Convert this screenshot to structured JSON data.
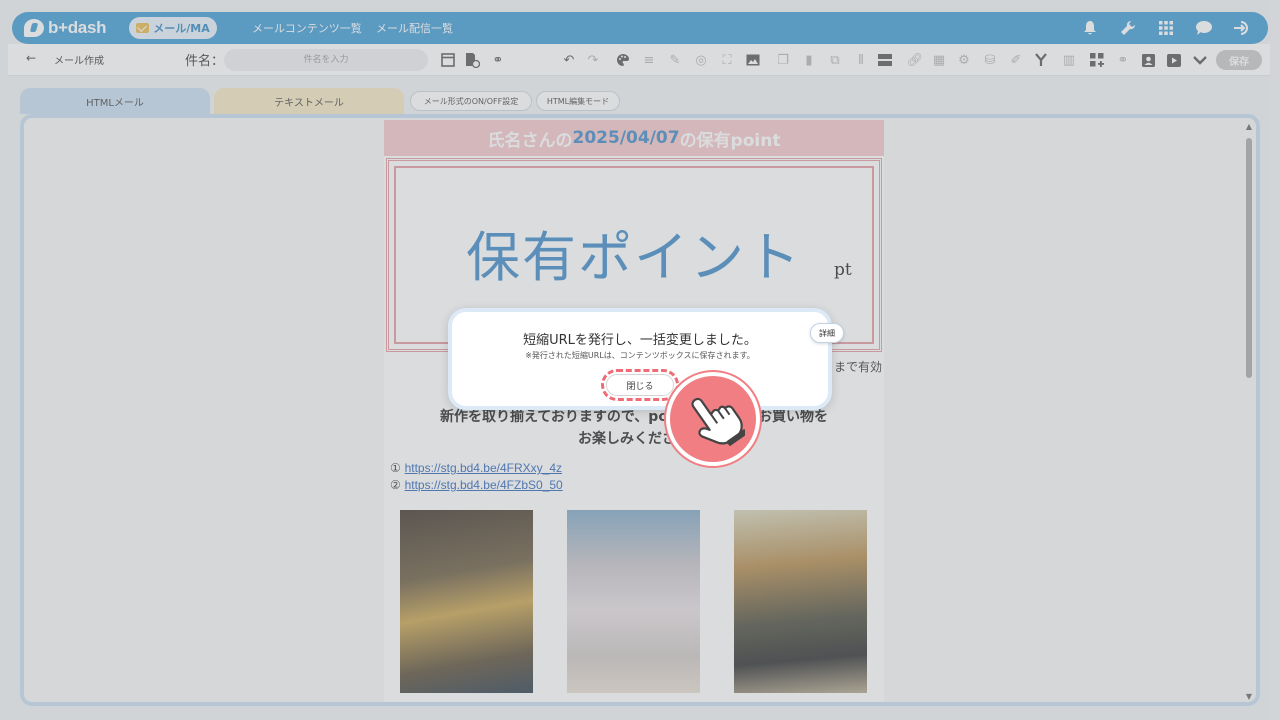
{
  "nav": {
    "logo_text": "b+dash",
    "pill_label": "メール/MA",
    "links": [
      "メールコンテンツ一覧",
      "メール配信一覧"
    ],
    "icons": [
      "bell-icon",
      "wrench-icon",
      "grid-icon",
      "chat-icon",
      "logout-icon"
    ]
  },
  "toolbar": {
    "title": "メール作成",
    "subject_label": "件名：",
    "subject_placeholder": "件名を入力",
    "save_label": "保存"
  },
  "tabs": {
    "html_label": "HTMLメール",
    "text_label": "テキストメール",
    "onoff_label": "メール形式のON/OFF設定",
    "edit_mode_label": "HTML編集モード"
  },
  "email": {
    "header_prefix": "氏名さんの",
    "header_date": "2025/04/07",
    "header_suffix": "の保有point",
    "points_title": "保有ポイント",
    "points_unit": "pt",
    "valid_text": "まで有効",
    "promo_line1": "新作を取り揃えておりますので、pointを使って、お買い物を",
    "promo_line2": "お楽しみください",
    "link1_prefix": "①",
    "link1": "https://stg.bd4.be/4FRXxy_4z",
    "link2_prefix": "②",
    "link2": "https://stg.bd4.be/4FZbS0_50"
  },
  "dialog": {
    "message": "短縮URLを発行し、一括変更しました。",
    "sub_message": "※発行された短縮URLは、コンテンツボックスに保存されます。",
    "detail_label": "詳細",
    "close_label": "閉じる"
  },
  "colors": {
    "nav_blue": "#3d9ad3",
    "header_pink": "#f6c7ca",
    "points_blue": "#3d89c6",
    "highlight_red": "#ef6b75"
  }
}
